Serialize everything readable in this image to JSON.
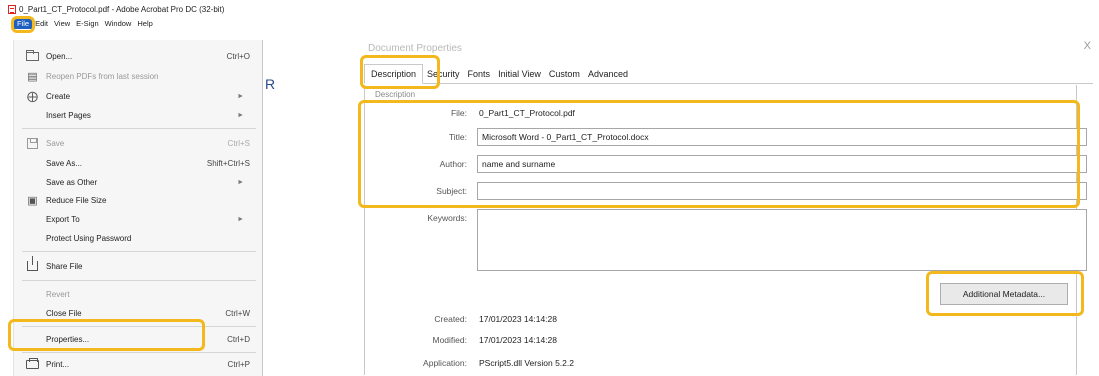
{
  "window": {
    "title": "0_Part1_CT_Protocol.pdf - Adobe Acrobat Pro DC (32-bit)"
  },
  "menubar": {
    "items": [
      "File",
      "Edit",
      "View",
      "E-Sign",
      "Window",
      "Help"
    ]
  },
  "file_menu": {
    "items": [
      {
        "label": "Open...",
        "shortcut": "Ctrl+O",
        "icon": "open-folder-icon",
        "disabled": false
      },
      {
        "label": "Reopen PDFs from last session",
        "shortcut": "",
        "icon": "reopen-icon",
        "disabled": true
      },
      {
        "label": "Create",
        "shortcut": "",
        "icon": "create-icon",
        "disabled": false,
        "submenu": true
      },
      {
        "label": "Insert Pages",
        "shortcut": "",
        "disabled": false,
        "submenu": true
      },
      {
        "label": "Save",
        "shortcut": "Ctrl+S",
        "icon": "save-icon",
        "disabled": true
      },
      {
        "label": "Save As...",
        "shortcut": "Shift+Ctrl+S",
        "disabled": false
      },
      {
        "label": "Save as Other",
        "shortcut": "",
        "disabled": false,
        "submenu": true
      },
      {
        "label": "Reduce File Size",
        "shortcut": "",
        "icon": "reduce-size-icon",
        "disabled": false
      },
      {
        "label": "Export To",
        "shortcut": "",
        "disabled": false,
        "submenu": true
      },
      {
        "label": "Protect Using Password",
        "shortcut": "",
        "disabled": false
      },
      {
        "label": "Share File",
        "shortcut": "",
        "icon": "share-icon",
        "disabled": false
      },
      {
        "label": "Revert",
        "shortcut": "",
        "disabled": true
      },
      {
        "label": "Close File",
        "shortcut": "Ctrl+W",
        "disabled": false
      },
      {
        "label": "Properties...",
        "shortcut": "Ctrl+D",
        "disabled": false,
        "highlighted": true
      },
      {
        "label": "Print...",
        "shortcut": "Ctrl+P",
        "icon": "print-icon",
        "disabled": false
      }
    ]
  },
  "dialog": {
    "title": "Document Properties",
    "close": "X",
    "tabs": [
      "Description",
      "Security",
      "Fonts",
      "Initial View",
      "Custom",
      "Advanced"
    ],
    "active_tab": "Description",
    "group_label": "Description",
    "fields": {
      "file_label": "File:",
      "file_value": "0_Part1_CT_Protocol.pdf",
      "title_label": "Title:",
      "title_value": "Microsoft Word - 0_Part1_CT_Protocol.docx",
      "author_label": "Author:",
      "author_value": "name and surname",
      "subject_label": "Subject:",
      "subject_value": "",
      "keywords_label": "Keywords:",
      "keywords_value": ""
    },
    "info": {
      "created_label": "Created:",
      "created_value": "17/01/2023 14:14:28",
      "modified_label": "Modified:",
      "modified_value": "17/01/2023 14:14:28",
      "application_label": "Application:",
      "application_value": "PScript5.dll Version 5.2.2"
    },
    "additional_metadata_button": "Additional Metadata..."
  },
  "colors": {
    "highlight": "#f2b81c",
    "file_menu_active": "#1f5fbf"
  }
}
